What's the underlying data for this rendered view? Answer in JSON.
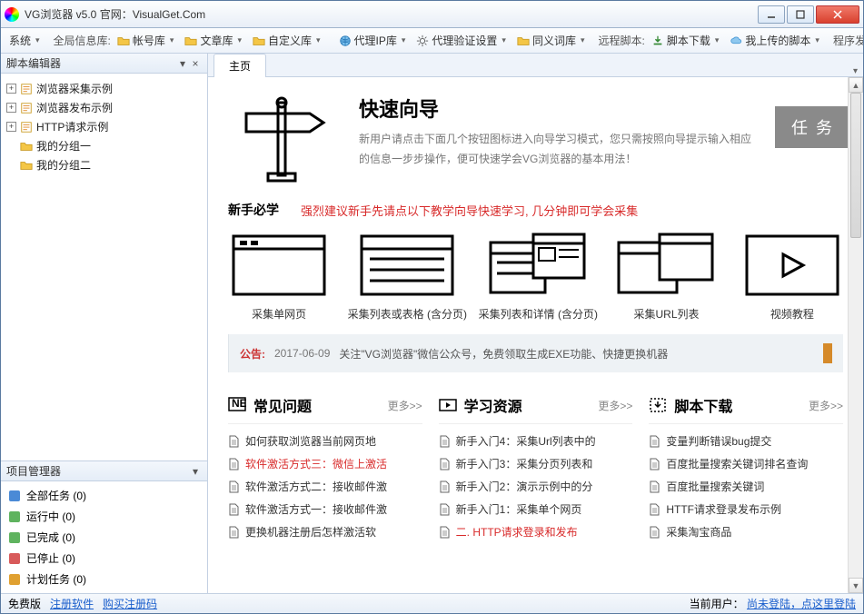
{
  "window": {
    "title": "VG浏览器 v5.0 官网：VisualGet.Com"
  },
  "toolbar": {
    "system": "系统",
    "globalInfo": "全局信息库:",
    "accounts": "帐号库",
    "articles": "文章库",
    "custom": "自定义库",
    "proxy": "代理IP库",
    "proxyVerify": "代理验证设置",
    "synonym": "同义词库",
    "remoteScript": "远程脚本:",
    "scriptDl": "脚本下载",
    "myUploads": "我上传的脚本",
    "publish": "程序发布:"
  },
  "leftPanel": {
    "scriptEditor": "脚本编辑器",
    "tree": [
      {
        "label": "浏览器采集示例",
        "exp": true
      },
      {
        "label": "浏览器发布示例",
        "exp": true
      },
      {
        "label": "HTTP请求示例",
        "exp": true
      },
      {
        "label": "我的分组一",
        "exp": false
      },
      {
        "label": "我的分组二",
        "exp": false
      }
    ],
    "projectMgr": "项目管理器",
    "pm": [
      {
        "label": "全部任务 (0)"
      },
      {
        "label": "运行中 (0)"
      },
      {
        "label": "已完成 (0)"
      },
      {
        "label": "已停止 (0)"
      },
      {
        "label": "计划任务 (0)"
      }
    ]
  },
  "mainTab": "主页",
  "wizard": {
    "title": "快速向导",
    "desc": "新用户请点击下面几个按钮图标进入向导学习模式，您只需按照向导提示输入相应的信息一步步操作，便可快速学会VG浏览器的基本用法！",
    "taskBadge": "任 务"
  },
  "newbie": {
    "label": "新手必学",
    "tip": "强烈建议新手先请点以下教学向导快速学习, 几分钟即可学会采集"
  },
  "cards": [
    "采集单网页",
    "采集列表或表格 (含分页)",
    "采集列表和详情 (含分页)",
    "采集URL列表",
    "视频教程"
  ],
  "notice": {
    "tag": "公告:",
    "date": "2017-06-09",
    "msg": "关注\"VG浏览器\"微信公众号，免费领取生成EXE功能、快捷更换机器"
  },
  "columns": {
    "more": "更多>>",
    "faq": {
      "title": "常见问题",
      "items": [
        {
          "t": "如何获取浏览器当前网页地",
          "red": false
        },
        {
          "t": "软件激活方式三：微信上激活",
          "red": true
        },
        {
          "t": "软件激活方式二：接收邮件激",
          "red": false
        },
        {
          "t": "软件激活方式一：接收邮件激",
          "red": false
        },
        {
          "t": "更换机器注册后怎样激活软",
          "red": false
        }
      ]
    },
    "learn": {
      "title": "学习资源",
      "items": [
        {
          "t": "新手入门4：采集Url列表中的",
          "red": false
        },
        {
          "t": "新手入门3：采集分页列表和",
          "red": false
        },
        {
          "t": "新手入门2：演示示例中的分",
          "red": false
        },
        {
          "t": "新手入门1：采集单个网页",
          "red": false
        },
        {
          "t": "二. HTTP请求登录和发布",
          "red": true
        }
      ]
    },
    "scripts": {
      "title": "脚本下载",
      "items": [
        {
          "t": "变量判断错误bug提交",
          "red": false
        },
        {
          "t": "百度批量搜索关键词排名查询",
          "red": false
        },
        {
          "t": "百度批量搜索关键词",
          "red": false
        },
        {
          "t": "HTTF请求登录发布示例",
          "red": false
        },
        {
          "t": "采集淘宝商品",
          "red": false
        }
      ]
    }
  },
  "status": {
    "edition": "免费版",
    "register": "注册软件",
    "buy": "购买注册码",
    "userLabel": "当前用户：",
    "login": "尚未登陆，点这里登陆"
  }
}
